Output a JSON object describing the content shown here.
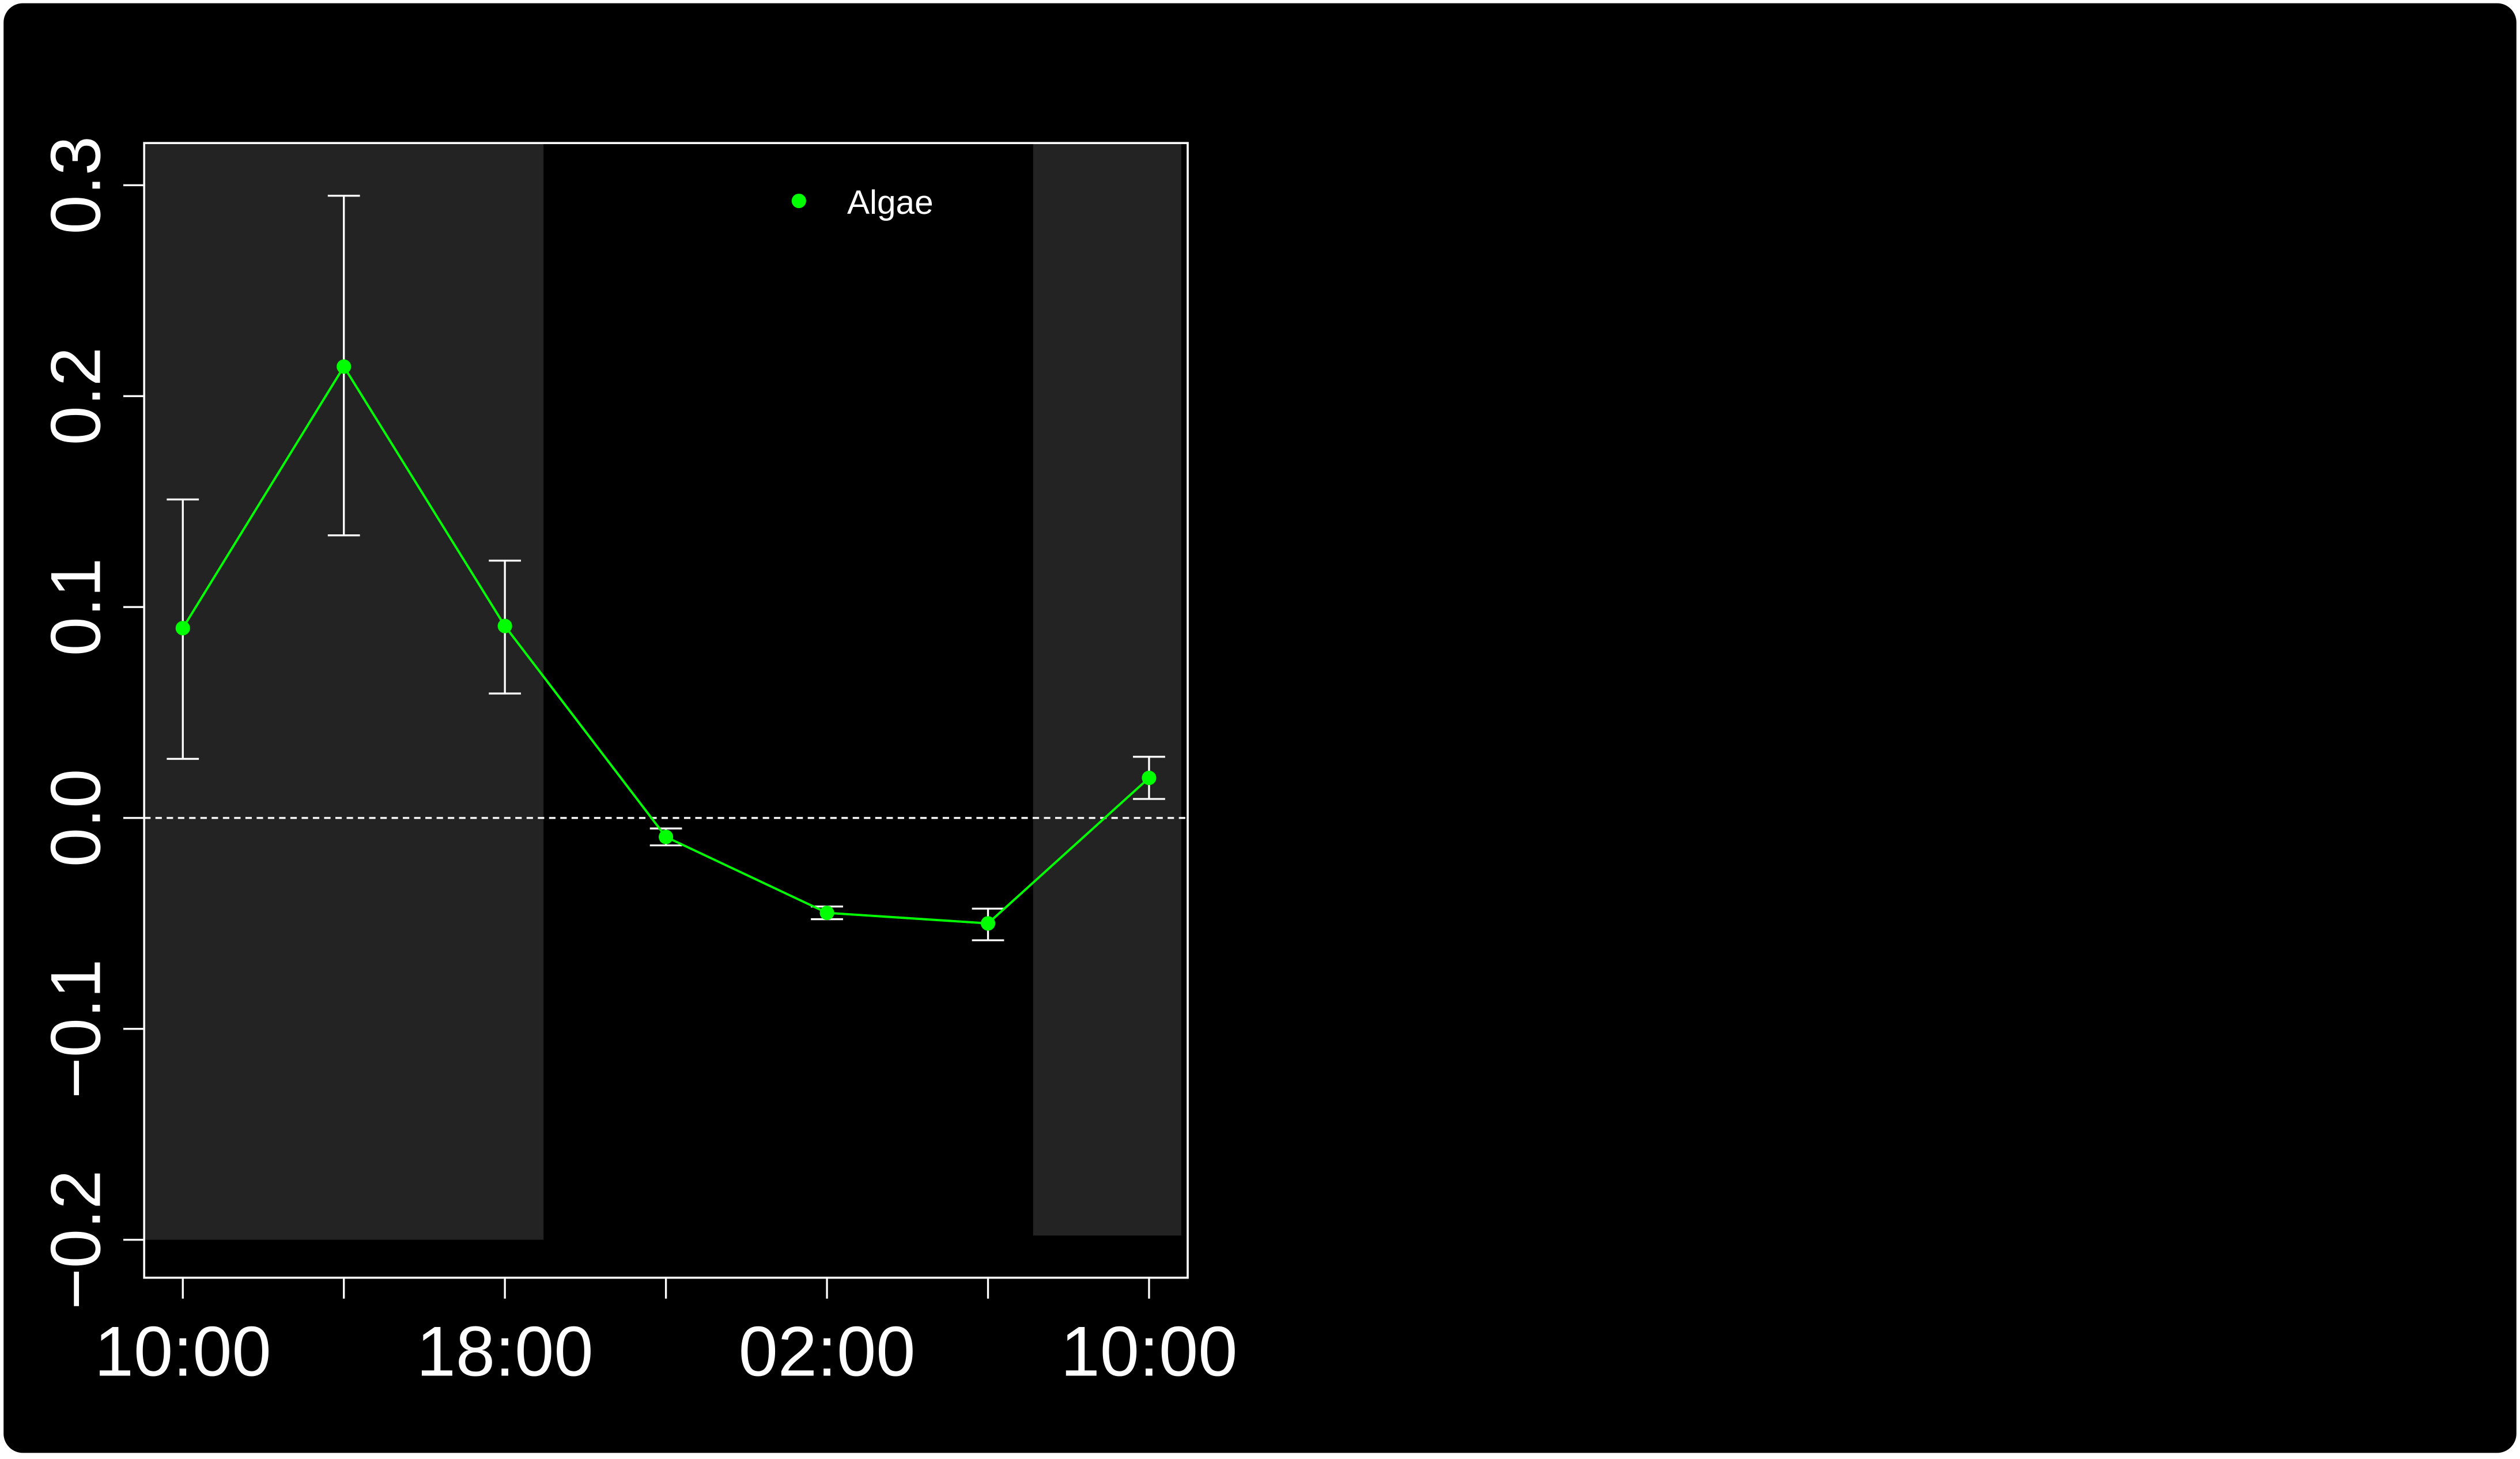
{
  "colors": {
    "background": "#000000",
    "panel": "#000000",
    "shade": "#232323",
    "axis": "#ffffff",
    "series": "#00ff00",
    "errorbar": "#ffffff",
    "zero_line": "#ffffff"
  },
  "chart_data": {
    "type": "line",
    "title": "",
    "xlabel": "",
    "ylabel": "",
    "x_ticks": [
      0,
      1,
      2,
      3,
      4,
      5,
      6
    ],
    "x_tick_labels": [
      {
        "at": 0,
        "label": "10:00"
      },
      {
        "at": 2,
        "label": "18:00"
      },
      {
        "at": 4,
        "label": "02:00"
      },
      {
        "at": 6,
        "label": "10:00"
      }
    ],
    "xlim": [
      -0.24,
      6.24
    ],
    "y_ticks": [
      -0.2,
      -0.1,
      0.0,
      0.1,
      0.2,
      0.3
    ],
    "y_tick_labels": [
      "−0.2",
      "−0.1",
      "0.0",
      "0.1",
      "0.2",
      "0.3"
    ],
    "ylim": [
      -0.218,
      0.32
    ],
    "grid": false,
    "legend": "top-center",
    "reference_line": {
      "y": 0.0,
      "style": "dashed"
    },
    "shaded_regions": [
      {
        "x0": -0.24,
        "x1": 2.24,
        "y0": -0.2,
        "y1": 0.32
      },
      {
        "x0": 5.28,
        "x1": 6.2,
        "y0": -0.198,
        "y1": 0.32
      }
    ],
    "series": [
      {
        "name": "Algae",
        "x": [
          0,
          1,
          2,
          3,
          4,
          5,
          6
        ],
        "y": [
          0.09,
          0.214,
          0.091,
          -0.009,
          -0.045,
          -0.05,
          0.019
        ],
        "lower": [
          0.028,
          0.134,
          0.059,
          -0.013,
          -0.048,
          -0.058,
          0.009
        ],
        "upper": [
          0.151,
          0.295,
          0.122,
          -0.005,
          -0.042,
          -0.043,
          0.029
        ]
      }
    ]
  }
}
